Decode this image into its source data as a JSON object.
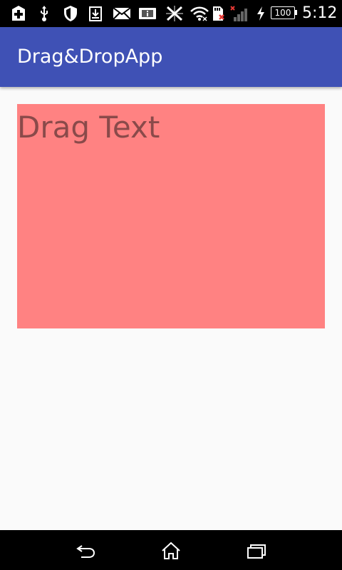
{
  "status_bar": {
    "icons": [
      "hospital-plus-icon",
      "usb-icon",
      "shield-icon",
      "download-icon",
      "mail-icon",
      "info-icon",
      "signal-blocked-icon",
      "wifi-icon",
      "sd-card-icon",
      "cell-signal-icon",
      "charging-icon"
    ],
    "battery": "100",
    "time": "5:12"
  },
  "app_bar": {
    "title": "Drag&DropApp",
    "color": "#3f51b5"
  },
  "content": {
    "drag_text": "Drag Text",
    "box_color": "#ff8282"
  },
  "nav_bar": {
    "icons": [
      "back-icon",
      "home-icon",
      "recents-icon"
    ]
  }
}
